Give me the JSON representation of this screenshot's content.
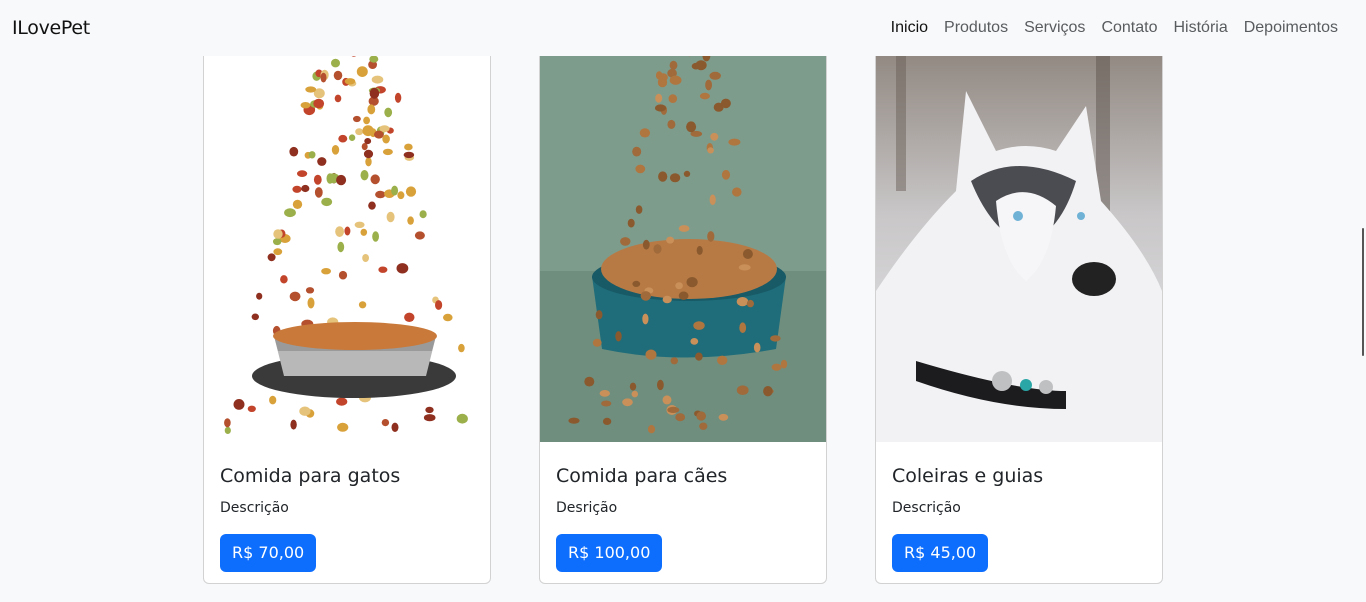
{
  "brand": "ILovePet",
  "nav": [
    {
      "label": "Inicio",
      "active": true
    },
    {
      "label": "Produtos"
    },
    {
      "label": "Serviços"
    },
    {
      "label": "Contato"
    },
    {
      "label": "História"
    },
    {
      "label": "Depoimentos"
    }
  ],
  "products": [
    {
      "title": "Comida para gatos",
      "description": "Descrição",
      "price": "R$ 70,00",
      "image": "cat-food-bowl-image"
    },
    {
      "title": "Comida para cães",
      "description": "Desrição",
      "price": "R$ 100,00",
      "image": "dog-food-bowl-image"
    },
    {
      "title": "Coleiras e guias",
      "description": "Descrição",
      "price": "R$ 45,00",
      "image": "husky-dog-image"
    }
  ],
  "colors": {
    "primary": "#0d6efd",
    "background": "#f8f9fa"
  }
}
